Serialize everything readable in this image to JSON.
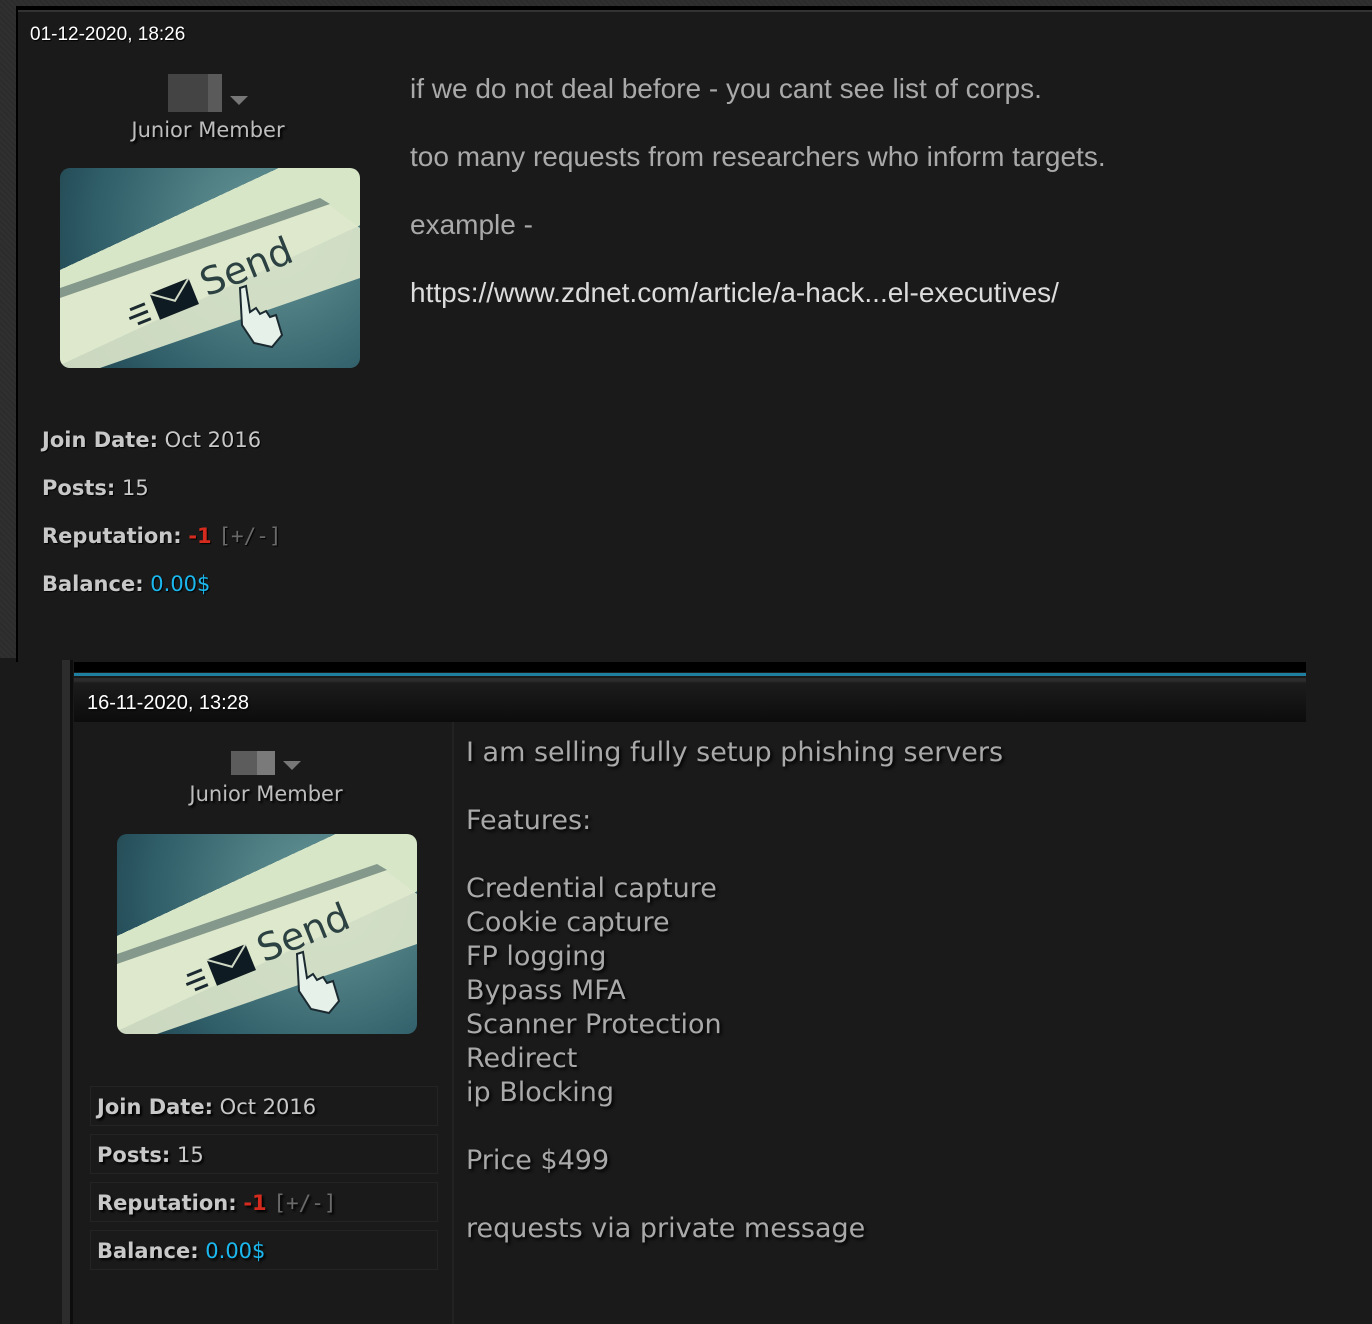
{
  "posts": [
    {
      "date": "01-12-2020, 18:26",
      "user": {
        "username_redacted": true,
        "title": "Junior Member",
        "avatar_alt": "Send button with envelope and hand cursor"
      },
      "stats": {
        "join_date_label": "Join Date:",
        "join_date": "Oct 2016",
        "posts_label": "Posts:",
        "posts": "15",
        "reputation_label": "Reputation:",
        "reputation": "-1",
        "reputation_link": "[+/-]",
        "balance_label": "Balance:",
        "balance": "0.00$"
      },
      "message": [
        "if we do not deal before - you cant see list of corps.",
        "too many requests from researchers who inform targets.",
        "example -",
        "https://www.zdnet.com/article/a-hack...el-executives/"
      ]
    },
    {
      "date": "16-11-2020, 13:28",
      "user": {
        "username_redacted": true,
        "title": "Junior Member",
        "avatar_alt": "Send button with envelope and hand cursor"
      },
      "stats": {
        "join_date_label": "Join Date:",
        "join_date": "Oct 2016",
        "posts_label": "Posts:",
        "posts": "15",
        "reputation_label": "Reputation:",
        "reputation": "-1",
        "reputation_link": "[+/-]",
        "balance_label": "Balance:",
        "balance": "0.00$"
      },
      "message": {
        "intro": "I am selling fully setup phishing servers",
        "features_label": "Features:",
        "features": [
          "Credential capture",
          "Cookie capture",
          "FP logging",
          "Bypass MFA",
          "Scanner Protection",
          "Redirect",
          "ip Blocking"
        ],
        "price": "Price $499",
        "contact": "requests via private message"
      }
    }
  ],
  "colors": {
    "reputation_negative": "#d42b1e",
    "balance": "#1bb8ef",
    "accent_bar": "#1f7fa0",
    "background": "#1a1a1a"
  }
}
